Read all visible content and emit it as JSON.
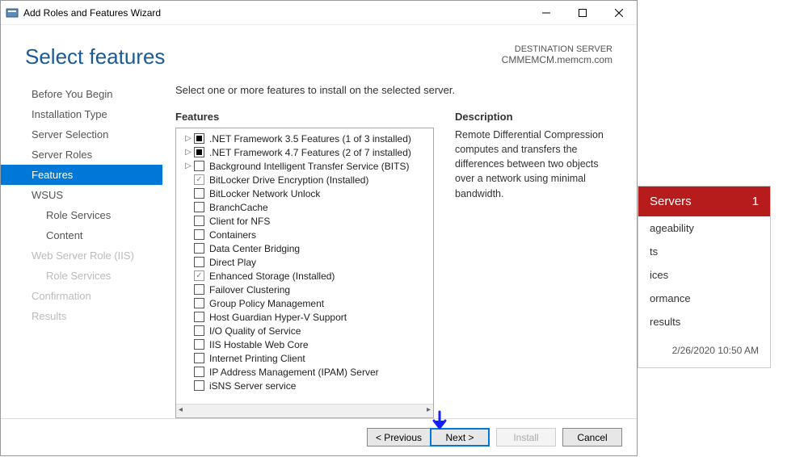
{
  "window": {
    "title": "Add Roles and Features Wizard"
  },
  "header": {
    "page_title": "Select features",
    "dest_label": "DESTINATION SERVER",
    "dest_server": "CMMEMCM.memcm.com"
  },
  "steps": [
    {
      "label": "Before You Begin",
      "state": "normal"
    },
    {
      "label": "Installation Type",
      "state": "normal"
    },
    {
      "label": "Server Selection",
      "state": "normal"
    },
    {
      "label": "Server Roles",
      "state": "normal"
    },
    {
      "label": "Features",
      "state": "selected"
    },
    {
      "label": "WSUS",
      "state": "normal"
    },
    {
      "label": "Role Services",
      "state": "sub"
    },
    {
      "label": "Content",
      "state": "sub"
    },
    {
      "label": "Web Server Role (IIS)",
      "state": "disabled"
    },
    {
      "label": "Role Services",
      "state": "disabled-sub"
    },
    {
      "label": "Confirmation",
      "state": "disabled"
    },
    {
      "label": "Results",
      "state": "disabled"
    }
  ],
  "main": {
    "instruction": "Select one or more features to install on the selected server.",
    "features_head": "Features",
    "description_head": "Description",
    "description_text": "Remote Differential Compression computes and transfers the differences between two objects over a network using minimal bandwidth."
  },
  "features": [
    {
      "label": ".NET Framework 3.5 Features (1 of 3 installed)",
      "check": "filled",
      "expand": true
    },
    {
      "label": ".NET Framework 4.7 Features (2 of 7 installed)",
      "check": "filled",
      "expand": true
    },
    {
      "label": "Background Intelligent Transfer Service (BITS)",
      "check": "empty",
      "expand": true
    },
    {
      "label": "BitLocker Drive Encryption (Installed)",
      "check": "checked-dim",
      "expand": false
    },
    {
      "label": "BitLocker Network Unlock",
      "check": "empty",
      "expand": false
    },
    {
      "label": "BranchCache",
      "check": "empty",
      "expand": false
    },
    {
      "label": "Client for NFS",
      "check": "empty",
      "expand": false
    },
    {
      "label": "Containers",
      "check": "empty",
      "expand": false
    },
    {
      "label": "Data Center Bridging",
      "check": "empty",
      "expand": false
    },
    {
      "label": "Direct Play",
      "check": "empty",
      "expand": false
    },
    {
      "label": "Enhanced Storage (Installed)",
      "check": "checked-dim",
      "expand": false
    },
    {
      "label": "Failover Clustering",
      "check": "empty",
      "expand": false
    },
    {
      "label": "Group Policy Management",
      "check": "empty",
      "expand": false
    },
    {
      "label": "Host Guardian Hyper-V Support",
      "check": "empty",
      "expand": false
    },
    {
      "label": "I/O Quality of Service",
      "check": "empty",
      "expand": false
    },
    {
      "label": "IIS Hostable Web Core",
      "check": "empty",
      "expand": false
    },
    {
      "label": "Internet Printing Client",
      "check": "empty",
      "expand": false
    },
    {
      "label": "IP Address Management (IPAM) Server",
      "check": "empty",
      "expand": false
    },
    {
      "label": "iSNS Server service",
      "check": "empty",
      "expand": false
    }
  ],
  "buttons": {
    "previous": "< Previous",
    "next": "Next >",
    "install": "Install",
    "cancel": "Cancel"
  },
  "backpanel": {
    "title": "Servers",
    "count": "1",
    "rows": [
      "ageability",
      "ts",
      "ices",
      "ormance",
      "results"
    ],
    "timestamp": "2/26/2020 10:50 AM"
  }
}
